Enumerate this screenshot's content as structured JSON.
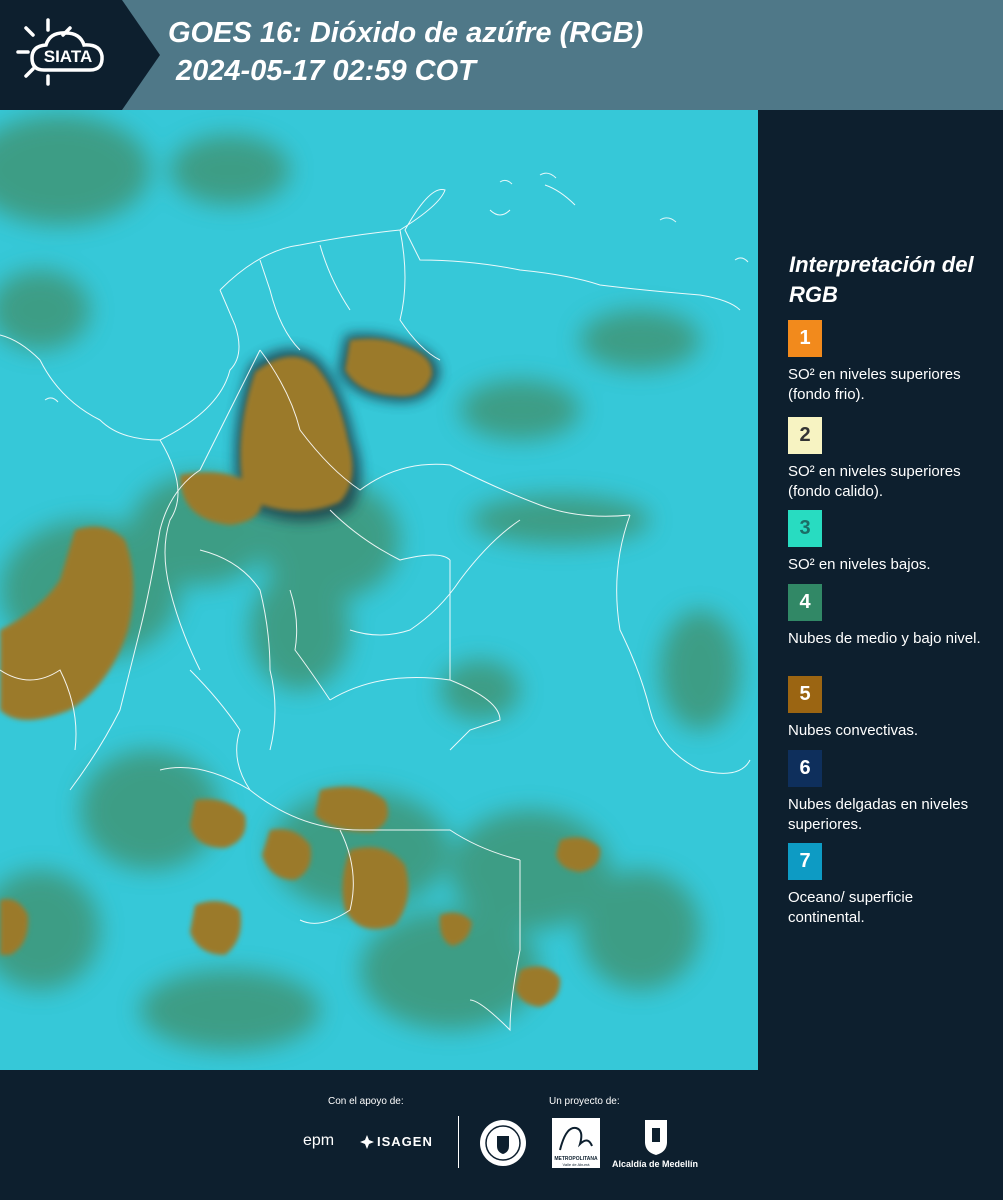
{
  "header": {
    "logo_text": "SIATA",
    "title_line1": "GOES 16: Dióxido de azúfre (RGB)",
    "title_line2": "2024-05-17 02:59 COT"
  },
  "legend": {
    "title": "Interpretación del RGB",
    "items": [
      {
        "number": "1",
        "color": "#f28a1c",
        "text": "SO² en niveles superiores (fondo frio)."
      },
      {
        "number": "2",
        "color": "#f7f3c2",
        "text": "SO² en niveles superiores (fondo calido)."
      },
      {
        "number": "3",
        "color": "#28dcc1",
        "text": "SO² en niveles bajos."
      },
      {
        "number": "4",
        "color": "#318866",
        "text": "Nubes de medio y bajo nivel."
      },
      {
        "number": "5",
        "color": "#9b6512",
        "text": "Nubes convectivas."
      },
      {
        "number": "6",
        "color": "#0e2f5c",
        "text": "Nubes delgadas en niveles superiores."
      },
      {
        "number": "7",
        "color": "#0d9bc4",
        "text": "Oceano/ superficie continental."
      }
    ]
  },
  "footer": {
    "support_label": "Con el apoyo de:",
    "project_label": "Un proyecto de:",
    "sponsor1": "epm",
    "sponsor2": "ISAGEN",
    "partner_metro_line1": "METROPOLITANA",
    "partner_metro_line2": "Valle de Aburrá",
    "partner_alcaldia": "Alcaldía de Medellín"
  },
  "colors": {
    "header_bg": "#4f7888",
    "page_bg": "#0d1f2e",
    "map_surface": "#33c6d6",
    "cloud_convective": "#9b7a2c",
    "cloud_low": "#3f8f6a"
  }
}
